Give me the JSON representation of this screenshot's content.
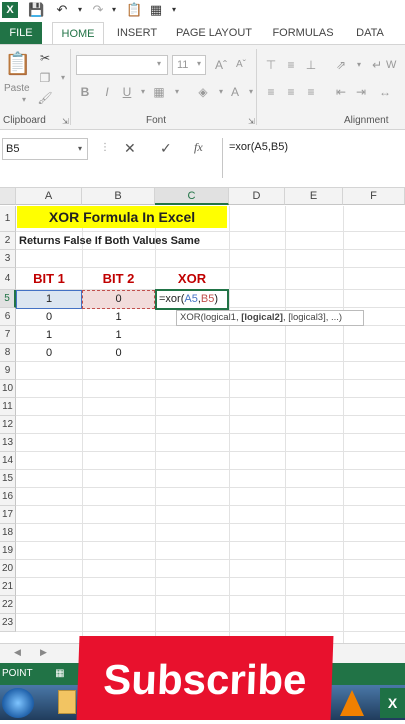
{
  "qat": {
    "app_badge": "X"
  },
  "tabs": [
    {
      "label": "FILE"
    },
    {
      "label": "HOME"
    },
    {
      "label": "INSERT"
    },
    {
      "label": "PAGE LAYOUT"
    },
    {
      "label": "FORMULAS"
    },
    {
      "label": "DATA"
    }
  ],
  "ribbon": {
    "clipboard": {
      "paste_label": "Paste",
      "group_label": "Clipboard"
    },
    "font": {
      "size": "11",
      "group_label": "Font",
      "bold": "B",
      "italic": "I",
      "underline": "U"
    },
    "alignment": {
      "group_label": "Alignment",
      "wrap": "W"
    }
  },
  "formula_bar": {
    "name_box": "B5",
    "formula": "=xor(A5,B5)"
  },
  "columns": [
    "A",
    "B",
    "C",
    "D",
    "E",
    "F"
  ],
  "rows": [
    "1",
    "2",
    "3",
    "4",
    "5",
    "6",
    "7",
    "8",
    "9",
    "10",
    "11",
    "12",
    "13",
    "14",
    "15",
    "16",
    "17",
    "18",
    "19",
    "20",
    "21",
    "22",
    "23"
  ],
  "sheet": {
    "title": "XOR Formula In Excel",
    "subtitle": "Returns False If Both Values Same",
    "headers": {
      "bit1": "BIT 1",
      "bit2": "BIT 2",
      "xor": "XOR"
    },
    "data": [
      {
        "a": "1",
        "b": "0"
      },
      {
        "a": "0",
        "b": "1"
      },
      {
        "a": "1",
        "b": "1"
      },
      {
        "a": "0",
        "b": "0"
      }
    ],
    "editing_cell": {
      "prefix": "=xor(",
      "ref1": "A5",
      "comma": ",",
      "ref2": "B5",
      "suffix": ")"
    },
    "tooltip": {
      "fn": "XOR(logical1, ",
      "bold": "[logical2]",
      "rest": ", [logical3], ...)"
    }
  },
  "status": {
    "mode": "POINT"
  },
  "overlay": {
    "subscribe": "Subscribe"
  },
  "taskbar": {
    "excel_badge": "X"
  },
  "colors": {
    "excel_green": "#217346",
    "title_fill": "#ffff00",
    "header_red": "#c00000",
    "subscribe_red": "#e8112d"
  }
}
